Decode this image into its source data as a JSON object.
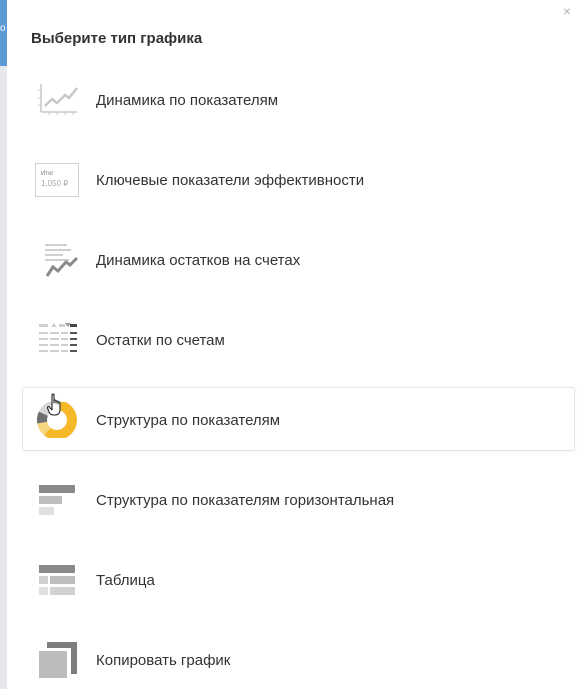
{
  "dialog": {
    "title": "Выберите тип графика",
    "close_glyph": "×"
  },
  "side_panel": {
    "accent_color": "#5b9bd5",
    "edge_text": "о"
  },
  "menu": {
    "items": [
      {
        "label": "Динамика по показателям",
        "icon": "line-chart-icon"
      },
      {
        "label": "Ключевые показатели эффективности",
        "icon": "kpi-card-icon",
        "icon_text_title": "Итог",
        "icon_text_value": "1,050 ₽"
      },
      {
        "label": "Динамика остатков на счетах",
        "icon": "balance-trend-icon"
      },
      {
        "label": "Остатки по счетам",
        "icon": "account-balances-icon"
      },
      {
        "label": "Структура по показателям",
        "icon": "donut-chart-icon",
        "state": "hover"
      },
      {
        "label": "Структура по показателям горизонтальная",
        "icon": "horizontal-bar-icon"
      },
      {
        "label": "Таблица",
        "icon": "table-icon"
      },
      {
        "label": "Копировать график",
        "icon": "copy-chart-icon"
      }
    ]
  },
  "colors": {
    "accent_yellow": "#f5b829",
    "icon_gray": "#9a9a9a"
  }
}
